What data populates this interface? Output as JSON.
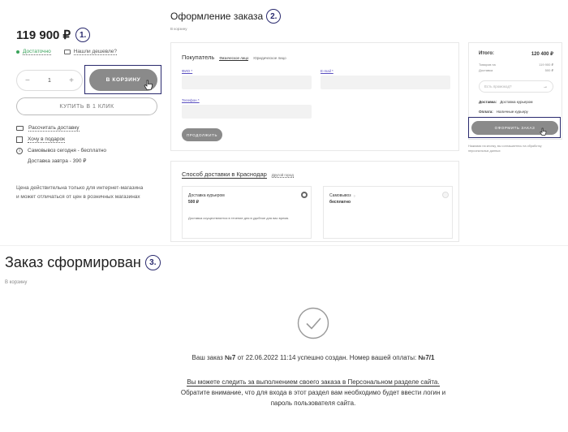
{
  "product": {
    "price": "119 900 ₽",
    "step": "1.",
    "stock": "Достаточно",
    "cheaper": "Нашли дешевле?",
    "qty": "1",
    "minus": "−",
    "plus": "+",
    "cart_btn": "В КОРЗИНУ",
    "oneclick_btn": "КУПИТЬ В 1 КЛИК",
    "links": [
      "Рассчитать доставку",
      "Хочу в подарок"
    ],
    "pickup": "Самовывоз сегодня - бесплатно",
    "delivery": "Доставка завтра - 390 ₽",
    "note": "Цена действительна только для интернет-магазина и может отличаться от цен в розничных магазинах"
  },
  "checkout": {
    "title": "Оформление заказа",
    "step": "2.",
    "breadcrumb": "В корзину",
    "buyer_label": "Покупатель",
    "tab_individual": "Физическое лицо",
    "tab_legal": "Юридическое лицо",
    "fio_label": "ФИО *",
    "email_label": "E-mail *",
    "phone_label": "Телефон *",
    "continue_btn": "ПРОДОЛЖИТЬ",
    "delivery_title": "Способ доставки в Краснодар",
    "other_city": "Другой город",
    "courier_name": "Доставка курьером",
    "courier_price": "500 ₽",
    "courier_desc": "Доставка осуществляется в течение дня в удобное для вас время.",
    "pickup_name": "Самовывоз",
    "pickup_price": "бесплатно",
    "summary": {
      "total_label": "Итого:",
      "total_value": "120 400 ₽",
      "goods_label": "Товаров на",
      "goods_value": "119 900 ₽",
      "delivery_label": "Доставка",
      "delivery_value": "500 ₽",
      "promo_placeholder": "Есть промокод?",
      "delivery_line_label": "Доставка:",
      "delivery_line_value": "Доставка курьером",
      "payment_label": "Оплата:",
      "payment_value": "Наличные курьеру",
      "order_btn": "ОФОРМИТЬ ЗАКАЗ",
      "consent": "Нажимая на кнопку, вы соглашаетесь на обработку персональных данных"
    }
  },
  "success": {
    "title": "Заказ сформирован",
    "step": "3.",
    "breadcrumb": "В корзину",
    "msg_pre": "Ваш заказ ",
    "order_no": "№7",
    "msg_mid": " от 22.06.2022 11:14 успешно создан. Номер вашей оплаты: ",
    "pay_no": "№7/1",
    "link_text": "Вы можете следить за выполнением своего заказа в Персональном разделе сайта.",
    "line2": "Обратите внимание, что для входа в этот раздел вам необходимо будет ввести логин и",
    "line3": "пароль пользователя сайта."
  },
  "colors": {
    "accent": "#2a2a6e",
    "button": "#8a8a8a",
    "stock": "#3aa35b"
  }
}
